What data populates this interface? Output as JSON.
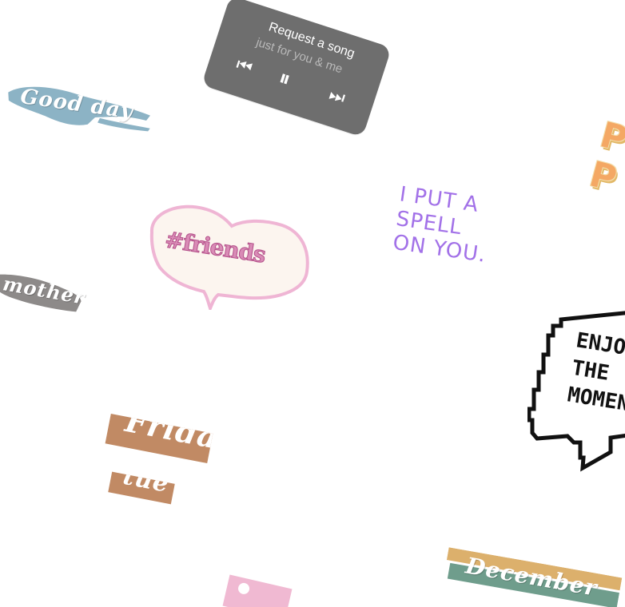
{
  "music_card": {
    "title": "Request a song",
    "subtitle": "just for you & me",
    "controls": {
      "prev": "⏮",
      "pause": "⏸",
      "next": "⏭"
    }
  },
  "stickers": {
    "good_day": "Good day",
    "mother": "mother",
    "friends": "#friends",
    "spell_lines": [
      "I PUT A",
      "SPELL",
      "ON YOU."
    ],
    "enjoy_lines": [
      "ENJO",
      "THE",
      "MOMENT"
    ],
    "peach_lines": [
      "P",
      "P"
    ],
    "friday": "Friday",
    "tue": "tue",
    "december": "December"
  },
  "colors": {
    "background": "#ffffff",
    "music_card": "#6e6e6e",
    "blue_brush": "#8cb3c5",
    "grey_brush": "#8d8a89",
    "heart_fill": "#fcf5ef",
    "heart_outline": "#efb5d4",
    "spell_text": "#a271e8",
    "brown_bar": "#c18a64",
    "december_top": "#dcb06c",
    "december_bottom": "#6f9d8c"
  }
}
